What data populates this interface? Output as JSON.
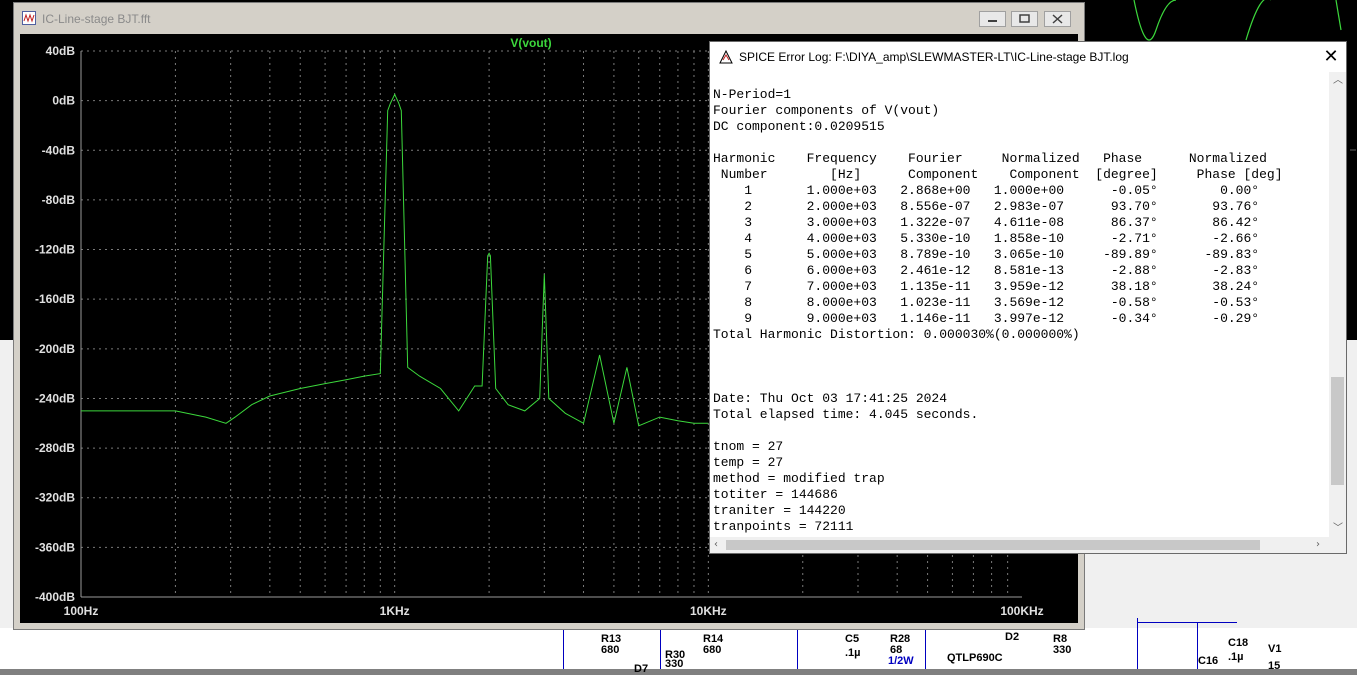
{
  "fft_window": {
    "title": "IC-Line-stage BJT.fft",
    "trace_label": "V(vout)",
    "trace_color": "#3cd83c",
    "y_ticks": [
      "40dB",
      "0dB",
      "-40dB",
      "-80dB",
      "-120dB",
      "-160dB",
      "-200dB",
      "-240dB",
      "-280dB",
      "-320dB",
      "-360dB",
      "-400dB"
    ],
    "x_ticks": [
      "100Hz",
      "1KHz",
      "10KHz",
      "100KHz"
    ]
  },
  "chart_data": {
    "type": "line",
    "title": "V(vout)",
    "xscale": "log",
    "xlim": [
      100,
      100000
    ],
    "ylim": [
      -400,
      40
    ],
    "grid": true,
    "series": [
      {
        "name": "V(vout)",
        "x": [
          100,
          150,
          200,
          250,
          290,
          310,
          350,
          400,
          500,
          600,
          700,
          800,
          900,
          950,
          970,
          1000,
          1030,
          1050,
          1100,
          1200,
          1400,
          1600,
          1800,
          1900,
          1980,
          2000,
          2020,
          2100,
          2300,
          2600,
          2900,
          3000,
          3100,
          3500,
          4000,
          4500,
          5000,
          5500,
          6000,
          7000,
          8000,
          9000,
          10000
        ],
        "y": [
          -250,
          -250,
          -250,
          -255,
          -260,
          -255,
          -245,
          -238,
          -232,
          -228,
          -225,
          -222,
          -220,
          -8,
          -2,
          5,
          -2,
          -8,
          -215,
          -222,
          -232,
          -250,
          -230,
          -230,
          -125,
          -123,
          -125,
          -232,
          -245,
          -250,
          -240,
          -140,
          -240,
          -252,
          -260,
          -205,
          -260,
          -215,
          -262,
          -255,
          -258,
          -260,
          -260
        ]
      }
    ]
  },
  "log_window": {
    "title": "SPICE Error Log: F:\\DIYA_amp\\SLEWMASTER-LT\\IC-Line-stage BJT.log",
    "lines": [
      "N-Period=1",
      "Fourier components of V(vout)",
      "DC component:0.0209515",
      "",
      "Harmonic    Frequency    Fourier     Normalized   Phase      Normalized",
      " Number        [Hz]      Component    Component  [degree]     Phase [deg]",
      "    1       1.000e+03   2.868e+00   1.000e+00      -0.05°        0.00°",
      "    2       2.000e+03   8.556e-07   2.983e-07      93.70°       93.76°",
      "    3       3.000e+03   1.322e-07   4.611e-08      86.37°       86.42°",
      "    4       4.000e+03   5.330e-10   1.858e-10      -2.71°       -2.66°",
      "    5       5.000e+03   8.789e-10   3.065e-10     -89.89°      -89.83°",
      "    6       6.000e+03   2.461e-12   8.581e-13      -2.88°       -2.83°",
      "    7       7.000e+03   1.135e-11   3.959e-12      38.18°       38.24°",
      "    8       8.000e+03   1.023e-11   3.569e-12      -0.58°       -0.53°",
      "    9       9.000e+03   1.146e-11   3.997e-12      -0.34°       -0.29°",
      "Total Harmonic Distortion: 0.000030%(0.000000%)",
      "",
      "",
      "",
      "Date: Thu Oct 03 17:41:25 2024",
      "Total elapsed time: 4.045 seconds.",
      "",
      "tnom = 27",
      "temp = 27",
      "method = modified trap",
      "totiter = 144686",
      "traniter = 144220",
      "tranpoints = 72111"
    ]
  },
  "schematic": {
    "labels": [
      {
        "id": "R13",
        "text": "R13"
      },
      {
        "id": "R13v",
        "text": "680"
      },
      {
        "id": "R30",
        "text": "R30"
      },
      {
        "id": "R30v",
        "text": "330"
      },
      {
        "id": "D7",
        "text": "D7"
      },
      {
        "id": "R14",
        "text": "R14"
      },
      {
        "id": "R14v",
        "text": "680"
      },
      {
        "id": "C5",
        "text": "C5"
      },
      {
        "id": "C5v",
        "text": ".1µ"
      },
      {
        "id": "R28",
        "text": "R28"
      },
      {
        "id": "R28v",
        "text": "68"
      },
      {
        "id": "R28p",
        "text": "1/2W"
      },
      {
        "id": "QTLP",
        "text": "QTLP690C"
      },
      {
        "id": "D2",
        "text": "D2"
      },
      {
        "id": "R8",
        "text": "R8"
      },
      {
        "id": "R8v",
        "text": "330"
      },
      {
        "id": "C18",
        "text": "C18"
      },
      {
        "id": "C18v",
        "text": ".1µ"
      },
      {
        "id": "C16",
        "text": "C16"
      },
      {
        "id": "V1",
        "text": "V1"
      },
      {
        "id": "V1v",
        "text": "15"
      }
    ]
  }
}
